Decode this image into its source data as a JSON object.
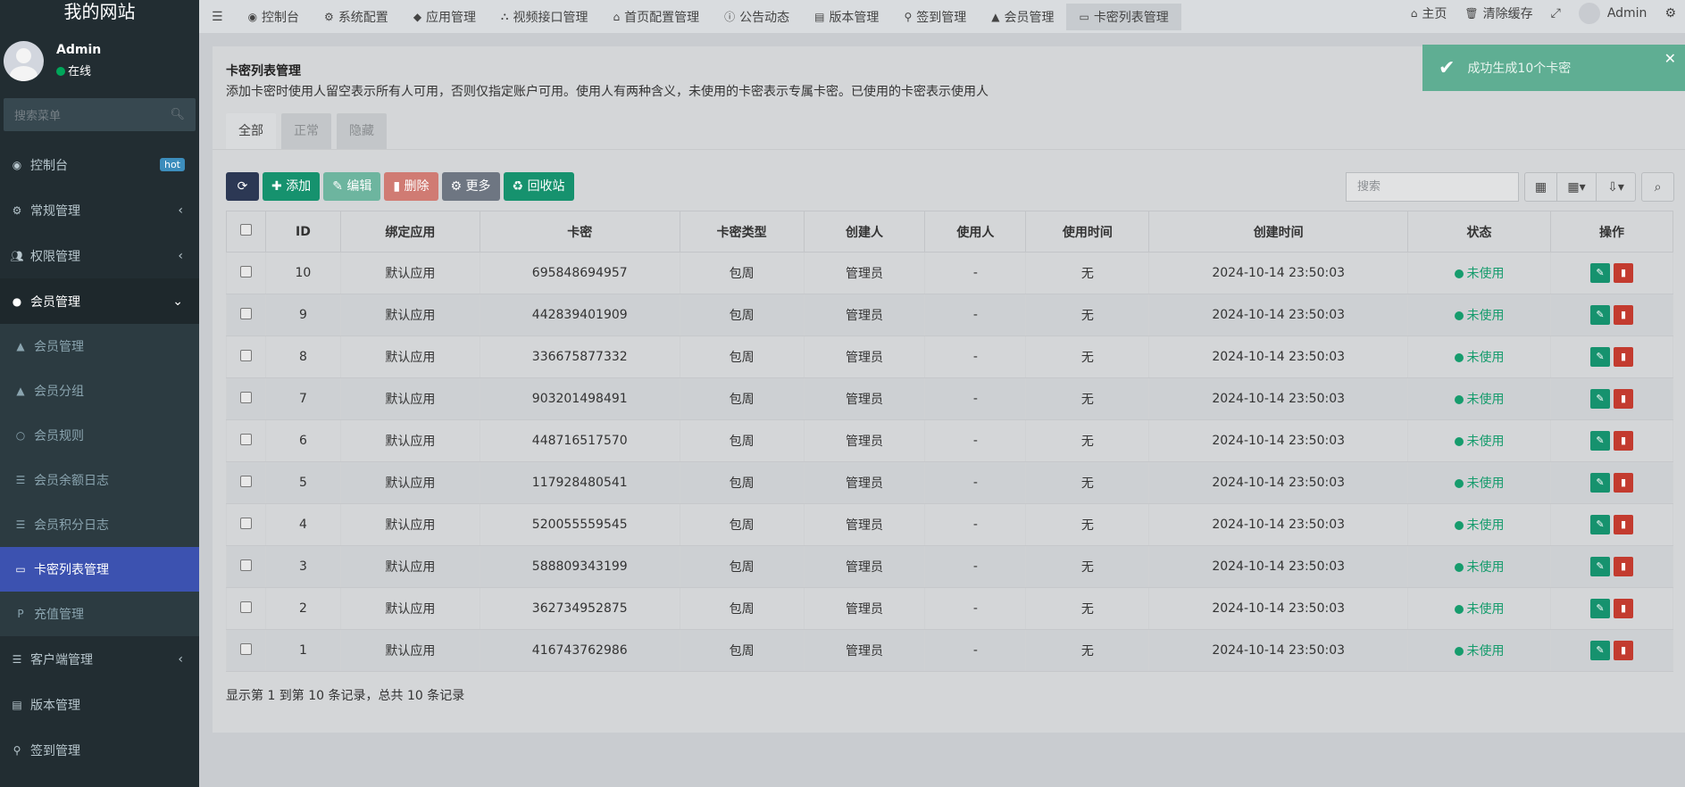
{
  "site": {
    "title": "我的网站"
  },
  "user": {
    "name": "Admin",
    "status": "在线"
  },
  "sidebar": {
    "search_placeholder": "搜索菜单",
    "items": [
      {
        "label": "控制台",
        "icon": "dashboard-icon",
        "badge": "hot"
      },
      {
        "label": "常规管理",
        "icon": "cogs-icon"
      },
      {
        "label": "权限管理",
        "icon": "group-icon"
      },
      {
        "label": "会员管理",
        "icon": "user-circle-icon"
      },
      {
        "label": "客户端管理",
        "icon": "list-icon"
      },
      {
        "label": "版本管理",
        "icon": "file-icon"
      },
      {
        "label": "签到管理",
        "icon": "map-marker-icon"
      }
    ],
    "sub_items": [
      {
        "label": "会员管理",
        "icon": "user-icon"
      },
      {
        "label": "会员分组",
        "icon": "users-icon"
      },
      {
        "label": "会员规则",
        "icon": "circle-icon"
      },
      {
        "label": "会员余额日志",
        "icon": "list-icon"
      },
      {
        "label": "会员积分日志",
        "icon": "list-icon"
      },
      {
        "label": "卡密列表管理",
        "icon": "card-icon"
      },
      {
        "label": "充值管理",
        "icon": "paypal-icon"
      }
    ]
  },
  "topbar": {
    "tabs": [
      "控制台",
      "系统配置",
      "应用管理",
      "视频接口管理",
      "首页配置管理",
      "公告动态",
      "版本管理",
      "签到管理",
      "会员管理",
      "卡密列表管理"
    ],
    "home": "主页",
    "clear_cache": "清除缓存",
    "admin": "Admin"
  },
  "toast": {
    "message": "成功生成10个卡密"
  },
  "panel": {
    "title": "卡密列表管理",
    "desc": "添加卡密时使用人留空表示所有人可用，否则仅指定账户可用。使用人有两种含义，未使用的卡密表示专属卡密。已使用的卡密表示使用人",
    "tabs": [
      "全部",
      "正常",
      "隐藏"
    ]
  },
  "toolbar": {
    "add": "添加",
    "edit": "编辑",
    "delete": "删除",
    "more": "更多",
    "recycle": "回收站",
    "search_placeholder": "搜索"
  },
  "table": {
    "headers": [
      "ID",
      "绑定应用",
      "卡密",
      "卡密类型",
      "创建人",
      "使用人",
      "使用时间",
      "创建时间",
      "状态",
      "操作"
    ],
    "rows": [
      {
        "id": "10",
        "app": "默认应用",
        "code": "695848694957",
        "type": "包周",
        "creator": "管理员",
        "user": "-",
        "used": "无",
        "created": "2024-10-14 23:50:03",
        "status": "未使用"
      },
      {
        "id": "9",
        "app": "默认应用",
        "code": "442839401909",
        "type": "包周",
        "creator": "管理员",
        "user": "-",
        "used": "无",
        "created": "2024-10-14 23:50:03",
        "status": "未使用"
      },
      {
        "id": "8",
        "app": "默认应用",
        "code": "336675877332",
        "type": "包周",
        "creator": "管理员",
        "user": "-",
        "used": "无",
        "created": "2024-10-14 23:50:03",
        "status": "未使用"
      },
      {
        "id": "7",
        "app": "默认应用",
        "code": "903201498491",
        "type": "包周",
        "creator": "管理员",
        "user": "-",
        "used": "无",
        "created": "2024-10-14 23:50:03",
        "status": "未使用"
      },
      {
        "id": "6",
        "app": "默认应用",
        "code": "448716517570",
        "type": "包周",
        "creator": "管理员",
        "user": "-",
        "used": "无",
        "created": "2024-10-14 23:50:03",
        "status": "未使用"
      },
      {
        "id": "5",
        "app": "默认应用",
        "code": "117928480541",
        "type": "包周",
        "creator": "管理员",
        "user": "-",
        "used": "无",
        "created": "2024-10-14 23:50:03",
        "status": "未使用"
      },
      {
        "id": "4",
        "app": "默认应用",
        "code": "520055559545",
        "type": "包周",
        "creator": "管理员",
        "user": "-",
        "used": "无",
        "created": "2024-10-14 23:50:03",
        "status": "未使用"
      },
      {
        "id": "3",
        "app": "默认应用",
        "code": "588809343199",
        "type": "包周",
        "creator": "管理员",
        "user": "-",
        "used": "无",
        "created": "2024-10-14 23:50:03",
        "status": "未使用"
      },
      {
        "id": "2",
        "app": "默认应用",
        "code": "362734952875",
        "type": "包周",
        "creator": "管理员",
        "user": "-",
        "used": "无",
        "created": "2024-10-14 23:50:03",
        "status": "未使用"
      },
      {
        "id": "1",
        "app": "默认应用",
        "code": "416743762986",
        "type": "包周",
        "creator": "管理员",
        "user": "-",
        "used": "无",
        "created": "2024-10-14 23:50:03",
        "status": "未使用"
      }
    ]
  },
  "footer": {
    "info": "显示第 1 到第 10 条记录，总共 10 条记录"
  }
}
